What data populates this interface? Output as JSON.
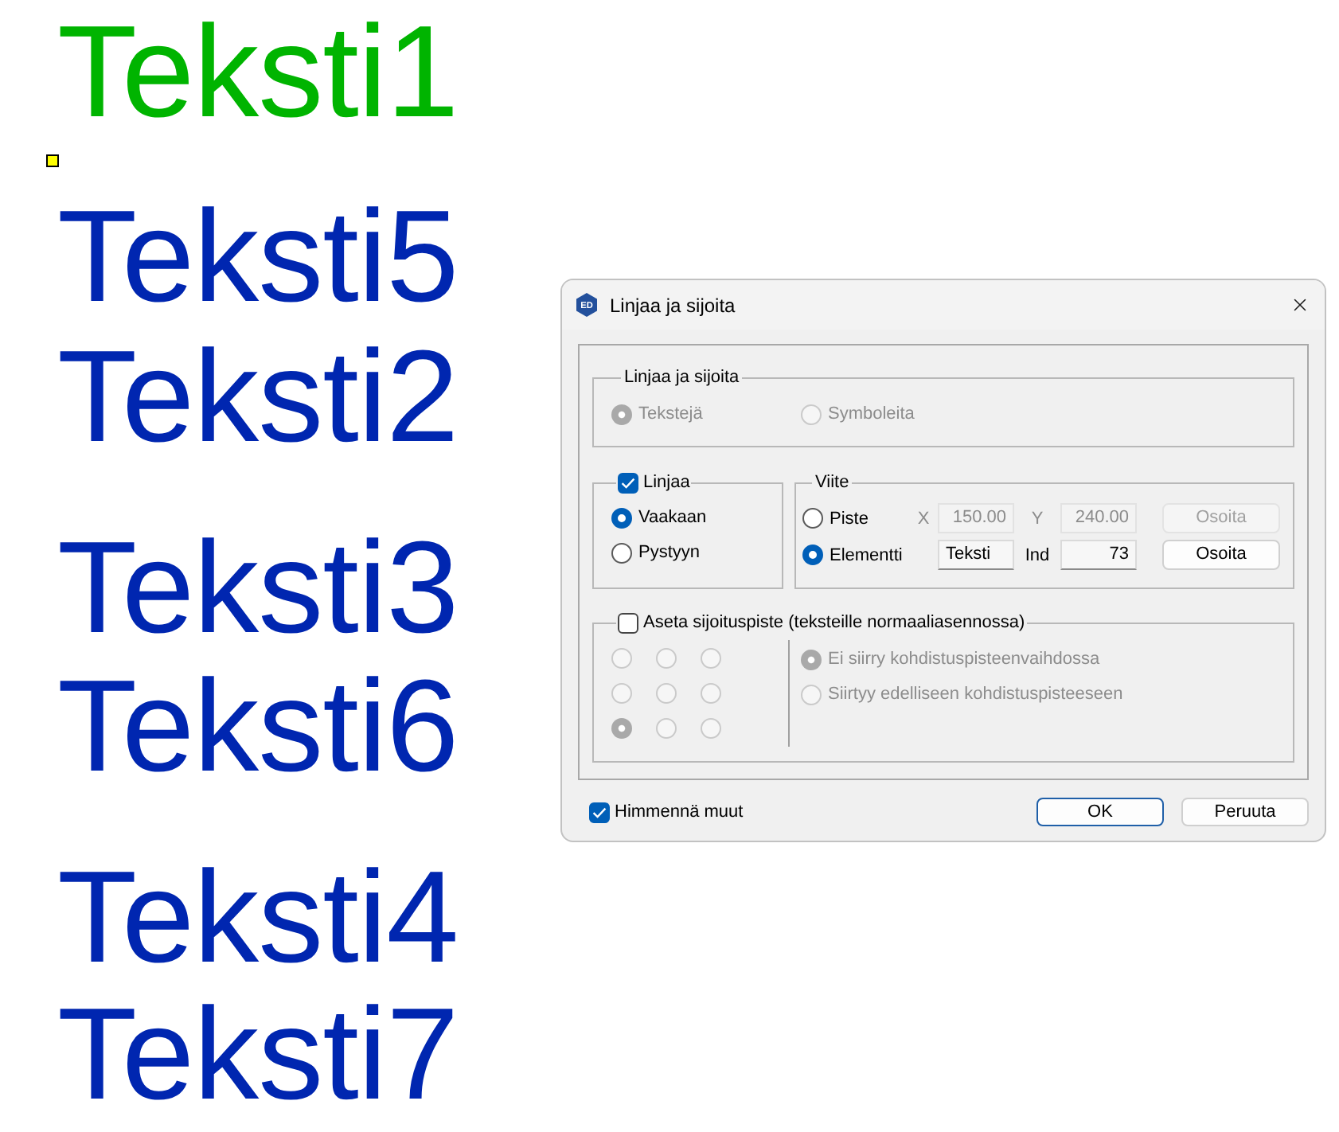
{
  "canvas": {
    "texts": [
      {
        "text": "Teksti1",
        "color": "#00b400"
      },
      {
        "text": "Teksti5",
        "color": "#0026b0"
      },
      {
        "text": "Teksti2",
        "color": "#0026b0"
      },
      {
        "text": "Teksti3",
        "color": "#0026b0"
      },
      {
        "text": "Teksti6",
        "color": "#0026b0"
      },
      {
        "text": "Teksti4",
        "color": "#0026b0"
      },
      {
        "text": "Teksti7",
        "color": "#0026b0"
      }
    ]
  },
  "dialog": {
    "icon_label": "ED",
    "title": "Linjaa ja sijoita",
    "target_group": {
      "title": "Linjaa ja sijoita",
      "disabled": true,
      "options": [
        {
          "label": "Tekstejä",
          "selected": true
        },
        {
          "label": "Symboleita",
          "selected": false
        }
      ]
    },
    "align_group": {
      "title": "Linjaa",
      "checked": true,
      "options": [
        {
          "label": "Vaakaan",
          "selected": true
        },
        {
          "label": "Pystyyn",
          "selected": false
        }
      ]
    },
    "reference_group": {
      "title": "Viite",
      "rows": [
        {
          "label": "Piste",
          "selected": false,
          "fields": [
            {
              "label": "X",
              "value": "150.00",
              "kind": "number",
              "disabled": true
            },
            {
              "label": "Y",
              "value": "240.00",
              "kind": "number",
              "disabled": true
            }
          ],
          "button": {
            "label": "Osoita",
            "disabled": true
          }
        },
        {
          "label": "Elementti",
          "selected": true,
          "fields": [
            {
              "value": "Teksti",
              "kind": "text",
              "disabled": false
            },
            {
              "label": "Ind",
              "value": "73",
              "kind": "number",
              "disabled": false
            }
          ],
          "button": {
            "label": "Osoita",
            "disabled": false
          }
        }
      ]
    },
    "placement_group": {
      "title": "Aseta sijoituspiste (teksteille normaaliasennossa)",
      "checked": false,
      "disabled": true,
      "grid": [
        {
          "selected": false
        },
        {
          "selected": false
        },
        {
          "selected": false
        },
        {
          "selected": false
        },
        {
          "selected": false
        },
        {
          "selected": false
        },
        {
          "selected": true
        },
        {
          "selected": false
        },
        {
          "selected": false
        }
      ],
      "options": [
        {
          "label": "Ei siirry kohdistuspisteenvaihdossa",
          "selected": true
        },
        {
          "label": "Siirtyy edelliseen kohdistuspisteeseen",
          "selected": false
        }
      ]
    },
    "dim_others": {
      "label": "Himmennä muut",
      "checked": true
    },
    "buttons": [
      {
        "label": "OK",
        "default": true
      },
      {
        "label": "Peruuta",
        "default": false
      }
    ]
  }
}
